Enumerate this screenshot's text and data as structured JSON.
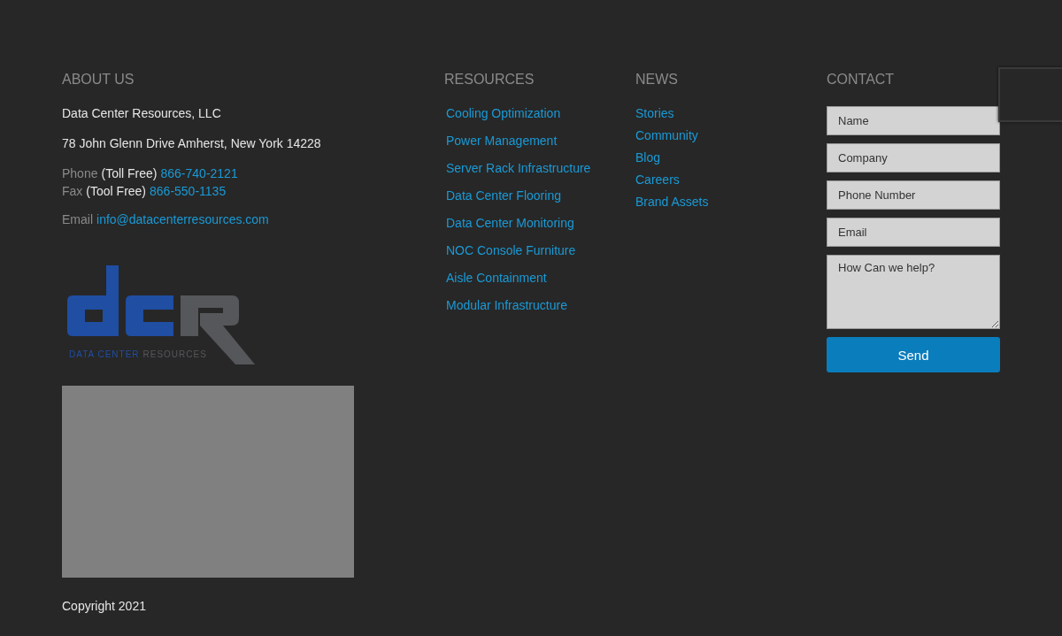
{
  "about": {
    "heading": "ABOUT US",
    "company": "Data Center Resources, LLC",
    "address": "78 John Glenn Drive Amherst, New York 14228",
    "phones": [
      {
        "label": "Phone",
        "note": "(Toll Free)",
        "number": "866-740-2121"
      },
      {
        "label": "Fax",
        "note": "(Tool Free)",
        "number": "866-550-1135"
      }
    ],
    "email": {
      "label": "Email",
      "address": "info@datacenterresources.com"
    },
    "logo": {
      "tagline_primary": "DATA CENTER",
      "tagline_secondary": "RESOURCES"
    }
  },
  "resources": {
    "heading": "RESOURCES",
    "links": [
      "Cooling Optimization",
      "Power Management",
      "Server Rack Infrastructure",
      "Data Center Flooring",
      "Data Center Monitoring",
      "NOC Console Furniture",
      "Aisle Containment",
      "Modular Infrastructure"
    ]
  },
  "news": {
    "heading": "NEWS",
    "links": [
      "Stories",
      "Community",
      "Blog",
      "Careers",
      "Brand Assets"
    ]
  },
  "contact": {
    "heading": "CONTACT",
    "fields": [
      {
        "kind": "input",
        "placeholder": "Name"
      },
      {
        "kind": "input",
        "placeholder": "Company"
      },
      {
        "kind": "input",
        "placeholder": "Phone Number"
      },
      {
        "kind": "input",
        "placeholder": "Email"
      },
      {
        "kind": "textarea",
        "placeholder": "How Can we help?"
      }
    ],
    "submit": "Send"
  },
  "copyright": "Copyright 2021"
}
